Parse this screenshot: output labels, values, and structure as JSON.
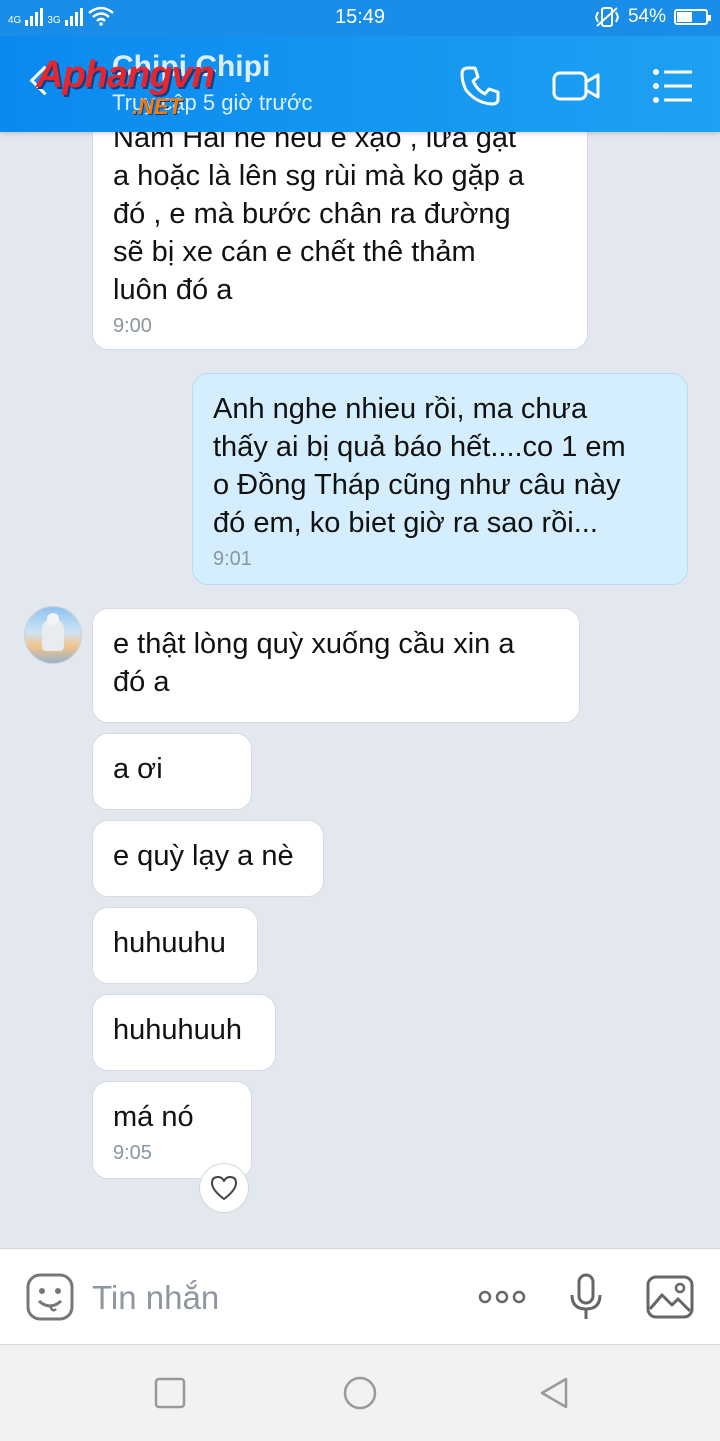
{
  "status_bar": {
    "time": "15:49",
    "network_1": "4G",
    "network_2": "3G",
    "battery_percent": "54%",
    "battery_level": 0.54
  },
  "header": {
    "contact_name": "Chipi Chipi",
    "last_active": "Truy cập 5 giờ trước",
    "watermark_main": "Aphangvn",
    "watermark_sub": ".NET"
  },
  "messages": [
    {
      "direction": "received",
      "text": "Nam Hải nè nếu e xạo , lừa gạt\na hoặc là lên sg rùi mà ko gặp a\nđó , e mà bước chân ra đường\nsẽ bị xe cán e chết thê thảm\nluôn đó a",
      "time": "9:00"
    },
    {
      "direction": "sent",
      "text": "Anh nghe nhieu rồi, ma chưa\nthấy ai bị quả báo hết....co 1 em\no Đồng Tháp cũng như câu này\nđó em, ko biet giờ ra sao rồi...",
      "time": "9:01"
    },
    {
      "direction": "received",
      "text": "e thật lòng quỳ xuống cầu xin a\nđó a",
      "time": ""
    },
    {
      "direction": "received",
      "text": "a ơi",
      "time": ""
    },
    {
      "direction": "received",
      "text": "e quỳ lạy a nè",
      "time": ""
    },
    {
      "direction": "received",
      "text": "huhuuhu",
      "time": ""
    },
    {
      "direction": "received",
      "text": "huhuhuuh",
      "time": ""
    },
    {
      "direction": "received",
      "text": "má nó",
      "time": "9:05"
    }
  ],
  "input": {
    "placeholder": "Tin nhắn"
  },
  "icons": {
    "header": [
      "back-icon",
      "phone-icon",
      "video-call-icon",
      "menu-icon"
    ],
    "input": [
      "sticker-icon",
      "more-icon",
      "microphone-icon",
      "image-icon"
    ],
    "nav": [
      "recent-apps-icon",
      "home-icon",
      "back-nav-icon"
    ],
    "reaction": "heart-icon"
  },
  "colors": {
    "header_blue": "#1a8de8",
    "sent_bubble": "#d5eefe",
    "received_bubble": "#ffffff",
    "chat_background": "#e3e8ef"
  }
}
